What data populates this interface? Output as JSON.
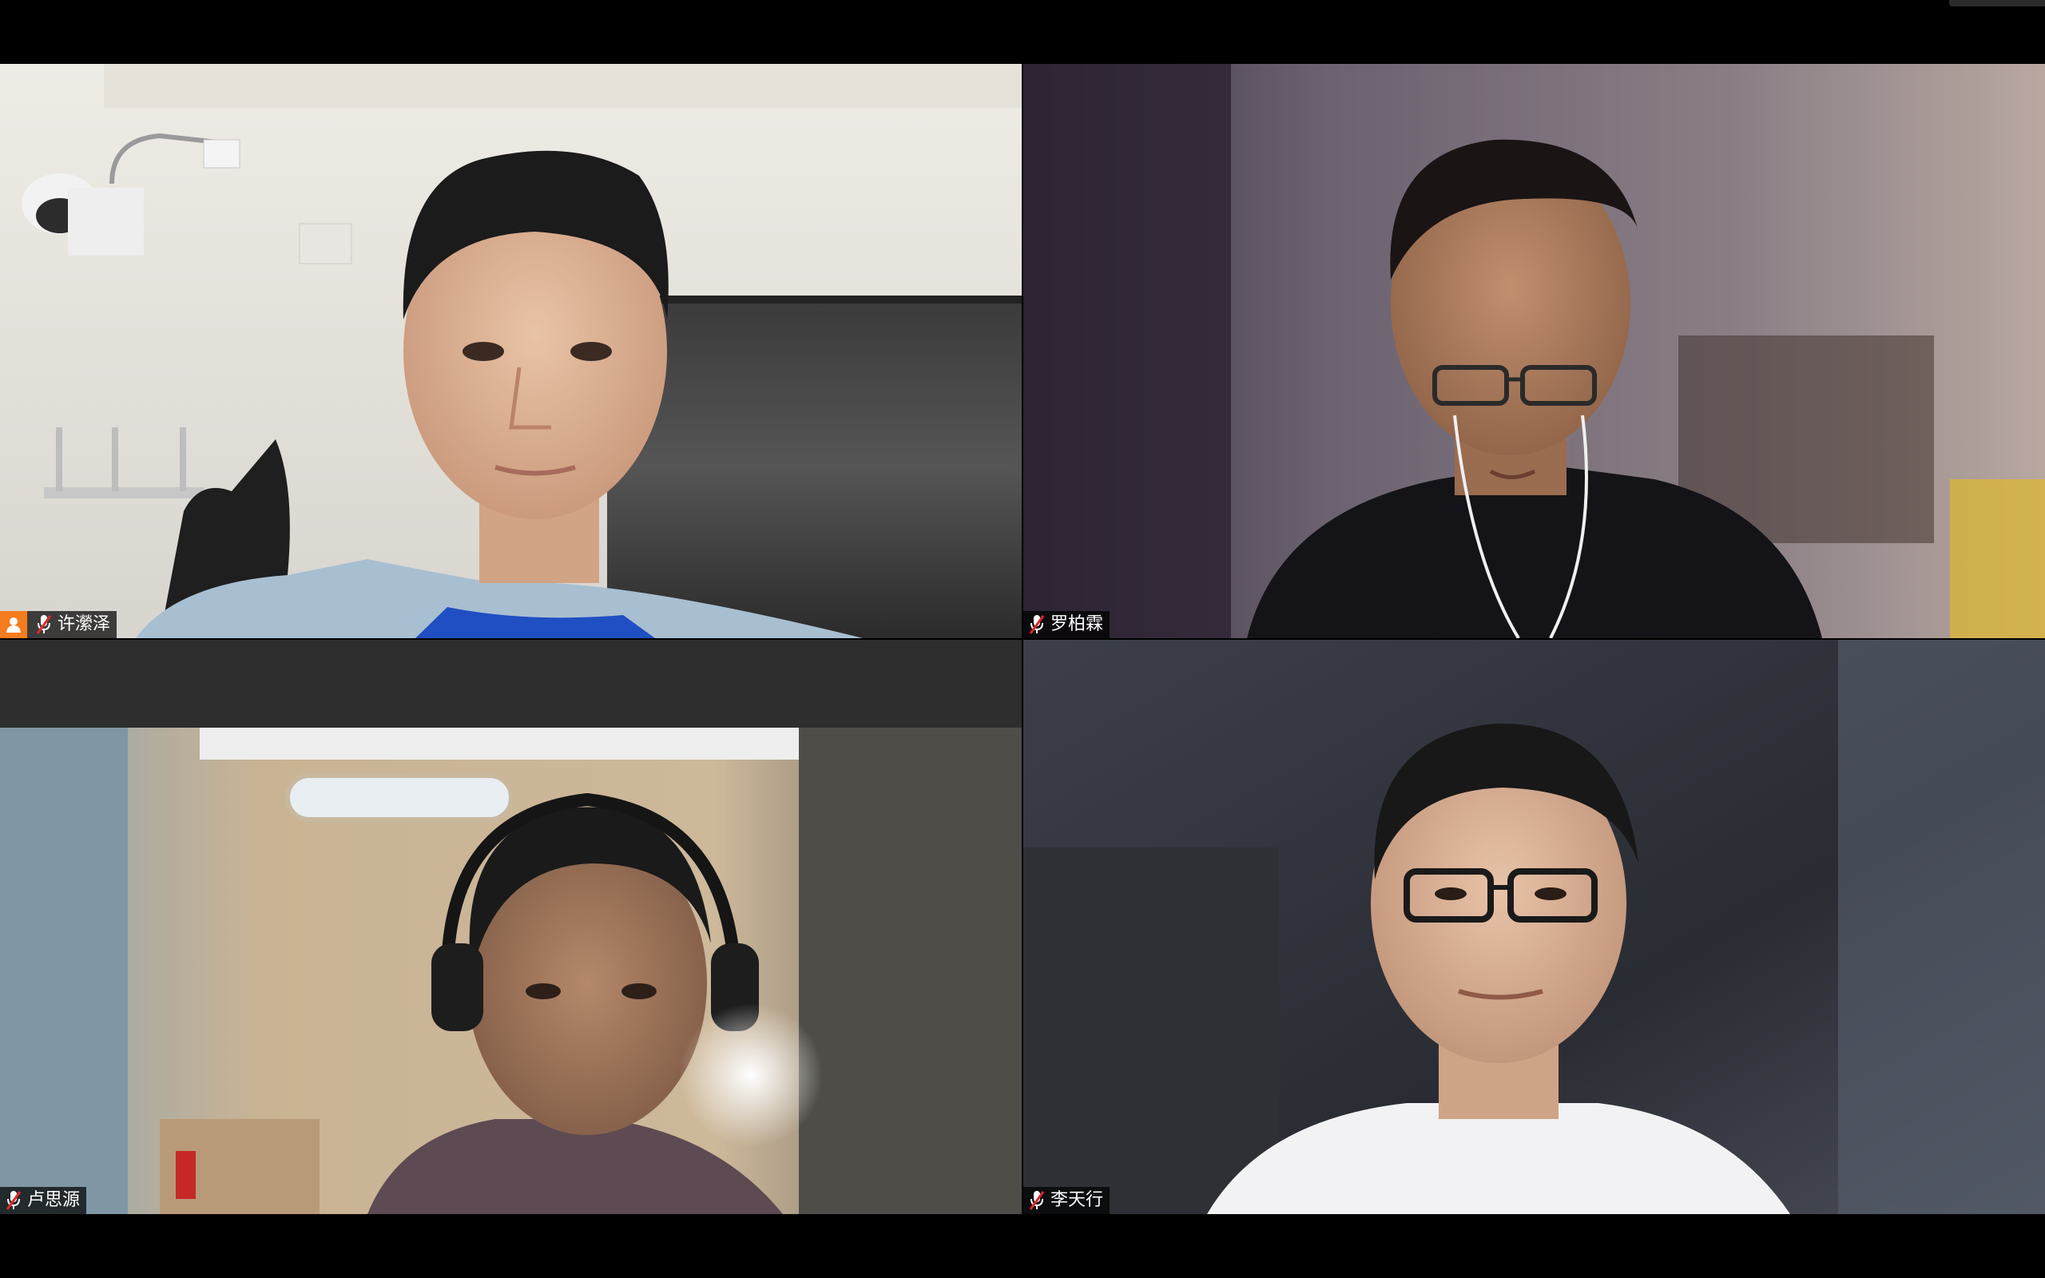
{
  "meeting": {
    "participants": [
      {
        "name": "许瀠泽",
        "is_host": true,
        "muted": true
      },
      {
        "name": "罗柏霖",
        "is_host": false,
        "muted": true
      },
      {
        "name": "卢思源",
        "is_host": false,
        "muted": true
      },
      {
        "name": "李天行",
        "is_host": false,
        "muted": true
      }
    ]
  },
  "icons": {
    "host": "host-person-icon",
    "muted": "muted-mic-icon"
  },
  "colors": {
    "background": "#000000",
    "host_badge": "#f57c1f",
    "muted_mic": "#e02828",
    "nametag_bg": "rgba(0,0,0,0.72)"
  }
}
